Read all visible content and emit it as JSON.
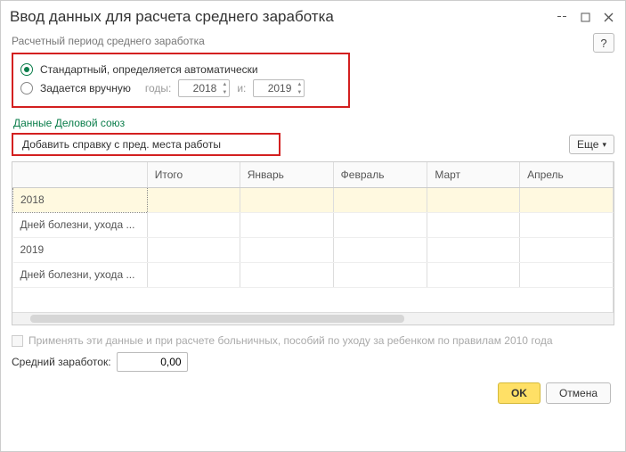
{
  "title": "Ввод данных для расчета среднего заработка",
  "period": {
    "label": "Расчетный период среднего заработка",
    "auto_label": "Стандартный, определяется автоматически",
    "manual_label": "Задается вручную",
    "years_word": "годы:",
    "and_word": "и:",
    "year1": "2018",
    "year2": "2019"
  },
  "data_section": {
    "title": "Данные Деловой союз",
    "add_ref_button": "Добавить справку с пред. места работы",
    "more": "Еще"
  },
  "table": {
    "headers": {
      "total": "Итого",
      "c1": "Январь",
      "c2": "Февраль",
      "c3": "Март",
      "c4": "Апрель"
    },
    "rows": {
      "r1": "2018",
      "r2": "Дней болезни, ухода ...",
      "r3": "2019",
      "r4": "Дней болезни, ухода ..."
    }
  },
  "apply_checkbox": "Применять эти данные и при расчете больничных, пособий по уходу за ребенком по правилам 2010 года",
  "avg": {
    "label": "Средний заработок:",
    "value": "0,00"
  },
  "footer": {
    "ok": "OK",
    "cancel": "Отмена"
  },
  "help": "?"
}
